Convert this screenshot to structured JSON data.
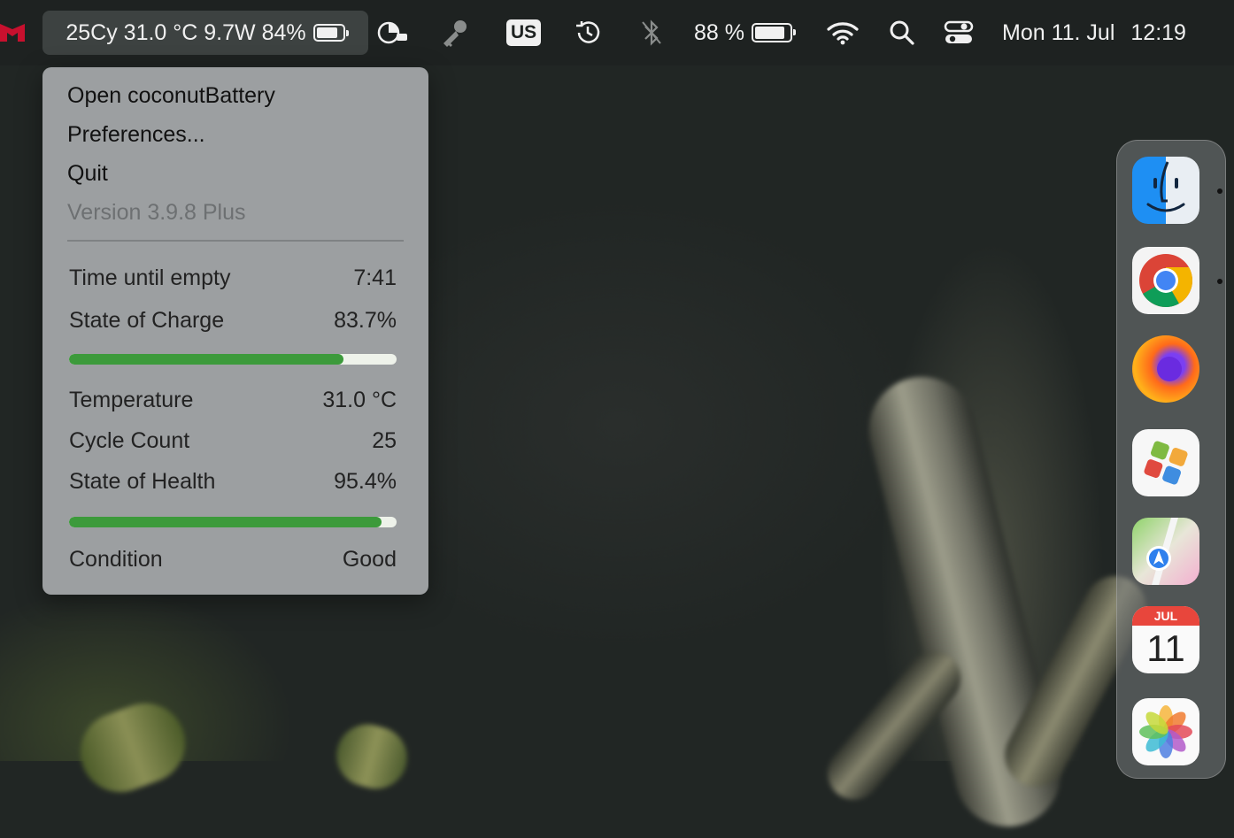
{
  "menubar": {
    "coconut_status": "25Cy 31.0 °C 9.7W 84%",
    "coconut_battery_level": 0.84,
    "input_source": "US",
    "battery_percent": "88 %",
    "battery_level": 0.88,
    "clock_date": "Mon 11. Jul",
    "clock_time": "12:19",
    "icons": [
      "mcafee-icon",
      "activity-chart-icon",
      "key-icon",
      "input-source-icon",
      "time-machine-icon",
      "bluetooth-icon",
      "battery-icon",
      "wifi-icon",
      "spotlight-search-icon",
      "control-center-icon"
    ]
  },
  "menu": {
    "items": [
      "Open coconutBattery",
      "Preferences...",
      "Quit"
    ],
    "version": "Version 3.9.8 Plus",
    "stats": {
      "time_until_empty_label": "Time until empty",
      "time_until_empty_value": "7:41",
      "state_of_charge_label": "State of Charge",
      "state_of_charge_value": "83.7%",
      "state_of_charge_level": 0.837,
      "temperature_label": "Temperature",
      "temperature_value": "31.0 °C",
      "cycle_count_label": "Cycle Count",
      "cycle_count_value": "25",
      "state_of_health_label": "State of Health",
      "state_of_health_value": "95.4%",
      "state_of_health_level": 0.954,
      "condition_label": "Condition",
      "condition_value": "Good"
    }
  },
  "dock": {
    "apps": [
      "finder-icon",
      "chrome-icon",
      "firefox-icon",
      "self-service-icon",
      "maps-icon",
      "calendar-icon",
      "photos-icon"
    ],
    "calendar_month": "JUL",
    "calendar_day": "11"
  },
  "colors": {
    "progress_fill": "#3c9a3b",
    "progress_track": "#eef2ea",
    "menu_bg": "#9c9fa1",
    "menubar_bg": "#1e2221"
  }
}
